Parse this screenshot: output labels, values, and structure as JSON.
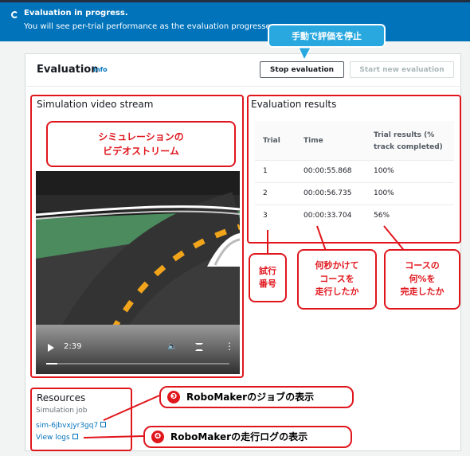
{
  "flash": {
    "title": "Evaluation in progress.",
    "message": "You will see per-trial performance as the evaluation progresses."
  },
  "header": {
    "title": "Evaluation",
    "info_link": "Info",
    "stop_button": "Stop evaluation",
    "start_button": "Start new evaluation"
  },
  "video": {
    "section_title": "Simulation video stream",
    "current_time": "2:39",
    "progress_fraction": 0.06
  },
  "results": {
    "section_title": "Evaluation results",
    "columns": [
      "Trial",
      "Time",
      "Trial results (%",
      "track completed)"
    ],
    "rows": [
      {
        "trial": "1",
        "time": "00:00:55.868",
        "result": "100%"
      },
      {
        "trial": "2",
        "time": "00:00:56.735",
        "result": "100%"
      },
      {
        "trial": "3",
        "time": "00:00:33.704",
        "result": "56%"
      }
    ]
  },
  "resources": {
    "section_title": "Resources",
    "job_label": "Simulation job",
    "job_link": "sim-6jbvxjyr3gq7",
    "logs_link": "View logs"
  },
  "annotations": {
    "stop_bubble": "手動で評価を停止",
    "video_callout_line1": "シミュレーションの",
    "video_callout_line2": "ビデオストリーム",
    "trial_callout_line1": "試行",
    "trial_callout_line2": "番号",
    "time_callout_line1": "何秒かけて",
    "time_callout_line2": "コースを",
    "time_callout_line3": "走行したか",
    "result_callout_line1": "コースの",
    "result_callout_line2": "何%を",
    "result_callout_line3": "完走したか",
    "note3_num": "❸",
    "note3_text": "RoboMakerのジョブの表示",
    "note4_num": "❹",
    "note4_text": "RoboMakerの走行ログの表示"
  },
  "colors": {
    "flash_blue": "#0073bb",
    "annotation_red": "#e0161d",
    "bubble_blue": "#29a8e0",
    "link_blue": "#0073bb"
  }
}
